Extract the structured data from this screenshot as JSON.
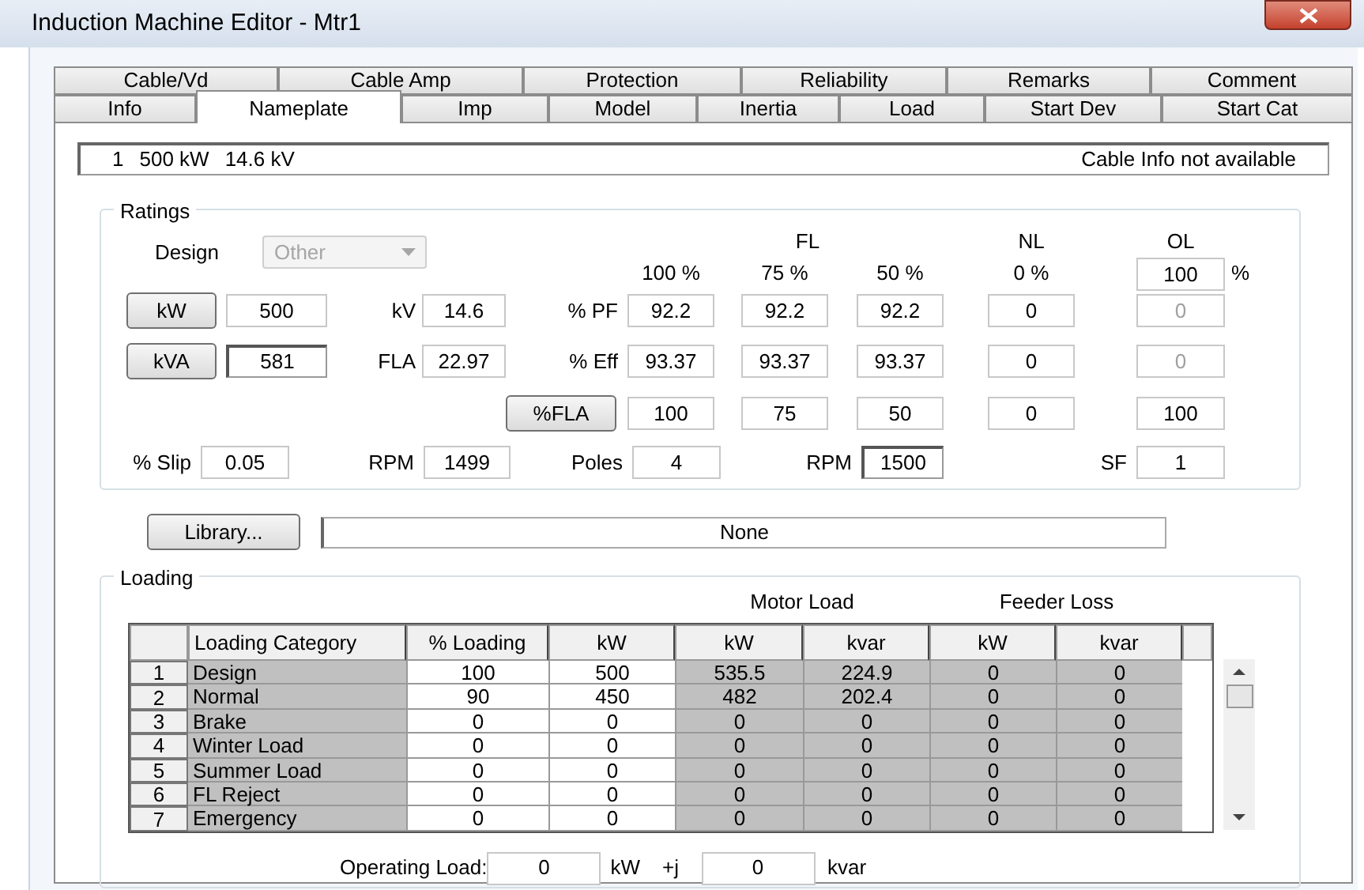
{
  "window": {
    "title": "Induction Machine Editor - Mtr1"
  },
  "tab_rows": [
    [
      {
        "label": "Cable/Vd",
        "selected": false
      },
      {
        "label": "Cable Amp",
        "selected": false
      },
      {
        "label": "Protection",
        "selected": false
      },
      {
        "label": "Reliability",
        "selected": false
      },
      {
        "label": "Remarks",
        "selected": false
      },
      {
        "label": "Comment",
        "selected": false
      }
    ],
    [
      {
        "label": "Info",
        "selected": false
      },
      {
        "label": "Nameplate",
        "selected": true
      },
      {
        "label": "Imp",
        "selected": false
      },
      {
        "label": "Model",
        "selected": false
      },
      {
        "label": "Inertia",
        "selected": false
      },
      {
        "label": "Load",
        "selected": false
      },
      {
        "label": "Start Dev",
        "selected": false
      },
      {
        "label": "Start Cat",
        "selected": false
      }
    ]
  ],
  "info_bar": {
    "texts": [
      "1",
      "500 kW",
      "14.6 kV"
    ],
    "cable_info": "Cable Info not available"
  },
  "ratings": {
    "title": "Ratings",
    "design": {
      "label": "Design",
      "value": "Other",
      "disabled": true
    },
    "group_headers": [
      "FL",
      "NL",
      "OL"
    ],
    "load_percents": [
      "100 %",
      "75 %",
      "50 %",
      "0 %"
    ],
    "ol_percent": {
      "value": "100",
      "unit": "%"
    },
    "rows": [
      {
        "kind": "labeled",
        "button": "kW",
        "button_value": {
          "value": "500",
          "readonly": false
        },
        "label": "kV",
        "label_value": {
          "value": "14.6",
          "readonly": false
        },
        "name": "% PF",
        "values": [
          {
            "value": "92.2",
            "disabled": false
          },
          {
            "value": "92.2",
            "disabled": false
          },
          {
            "value": "92.2",
            "disabled": false
          },
          {
            "value": "0",
            "disabled": false
          },
          {
            "value": "0",
            "disabled": true
          }
        ]
      },
      {
        "kind": "labeled",
        "button": "kVA",
        "button_value": {
          "value": "581",
          "readonly": true
        },
        "label": "FLA",
        "label_value": {
          "value": "22.97",
          "readonly": false
        },
        "name": "% Eff",
        "values": [
          {
            "value": "93.37",
            "disabled": false
          },
          {
            "value": "93.37",
            "disabled": false
          },
          {
            "value": "93.37",
            "disabled": false
          },
          {
            "value": "0",
            "disabled": false
          },
          {
            "value": "0",
            "disabled": true
          }
        ]
      },
      {
        "kind": "button_only",
        "button": "%FLA",
        "values": [
          {
            "value": "100",
            "disabled": false
          },
          {
            "value": "75",
            "disabled": false
          },
          {
            "value": "50",
            "disabled": false
          },
          {
            "value": "0",
            "disabled": false
          },
          {
            "value": "100",
            "disabled": false
          }
        ]
      }
    ],
    "speed_fields": [
      {
        "label": "% Slip",
        "value": "0.05",
        "readonly": false
      },
      {
        "label": "RPM",
        "value": "1499",
        "readonly": false
      },
      {
        "label": "Poles",
        "value": "4",
        "readonly": false
      },
      {
        "label": "RPM",
        "value": "1500",
        "readonly": true
      },
      {
        "label": "SF",
        "value": "1",
        "readonly": false
      }
    ]
  },
  "library": {
    "button": "Library...",
    "value": "None"
  },
  "loading": {
    "title": "Loading",
    "group_headers": [
      "Motor Load",
      "Feeder Loss"
    ],
    "columns": [
      "Loading Category",
      "% Loading",
      "kW",
      "kW",
      "kvar",
      "kW",
      "kvar"
    ],
    "rows": [
      {
        "number": "1",
        "category": "Design",
        "values": [
          "100",
          "500",
          "535.5",
          "224.9",
          "0",
          "0"
        ]
      },
      {
        "number": "2",
        "category": "Normal",
        "values": [
          "90",
          "450",
          "482",
          "202.4",
          "0",
          "0"
        ]
      },
      {
        "number": "3",
        "category": "Brake",
        "values": [
          "0",
          "0",
          "0",
          "0",
          "0",
          "0"
        ]
      },
      {
        "number": "4",
        "category": "Winter Load",
        "values": [
          "0",
          "0",
          "0",
          "0",
          "0",
          "0"
        ]
      },
      {
        "number": "5",
        "category": "Summer Load",
        "values": [
          "0",
          "0",
          "0",
          "0",
          "0",
          "0"
        ]
      },
      {
        "number": "6",
        "category": "FL Reject",
        "values": [
          "0",
          "0",
          "0",
          "0",
          "0",
          "0"
        ]
      },
      {
        "number": "7",
        "category": "Emergency",
        "values": [
          "0",
          "0",
          "0",
          "0",
          "0",
          "0"
        ]
      }
    ],
    "operating_load": {
      "label": "Operating Load:",
      "kw": "0",
      "kw_unit": "kW",
      "j": "+j",
      "kvar": "0",
      "kvar_unit": "kvar"
    }
  }
}
